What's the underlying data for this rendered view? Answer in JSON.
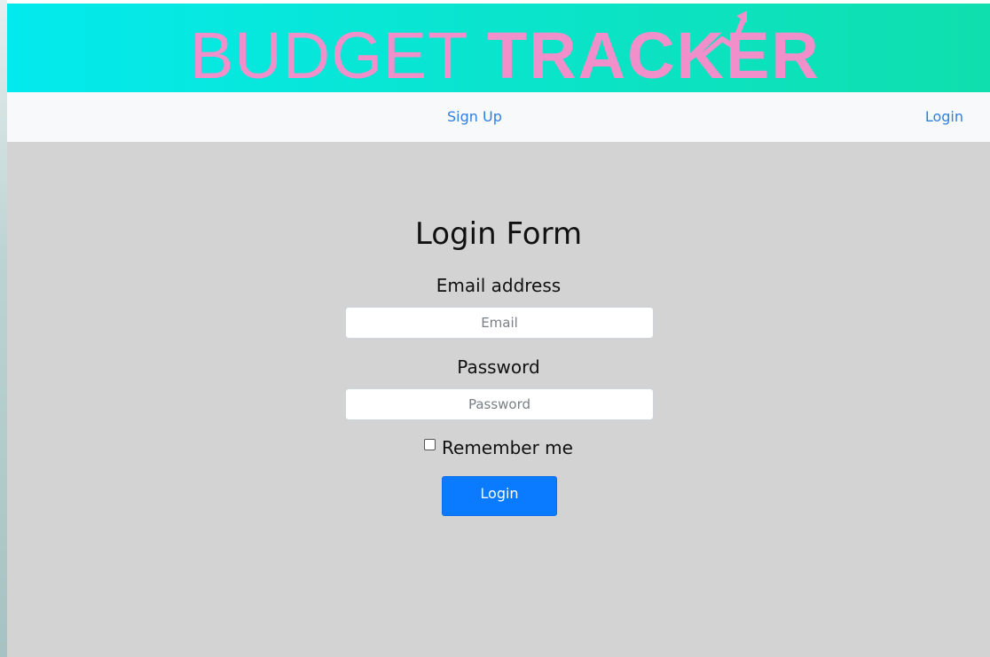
{
  "brand": {
    "logo_word_1": "BUDGET",
    "logo_word_2": "TRACKER",
    "logo_color": "#f08fc9",
    "icon": "trending-up-arrow-icon"
  },
  "navbar": {
    "signup_label": "Sign Up",
    "login_label": "Login"
  },
  "form": {
    "title": "Login Form",
    "email_label": "Email address",
    "email_placeholder": "Email",
    "email_value": "",
    "password_label": "Password",
    "password_placeholder": "Password",
    "password_value": "",
    "remember_label": "Remember me",
    "remember_checked": false,
    "submit_label": "Login"
  },
  "colors": {
    "banner_start": "#03eaee",
    "banner_end": "#0fdfae",
    "link": "#2f7fe0",
    "background": "#d3d3d3",
    "button": "#0a7bff"
  }
}
